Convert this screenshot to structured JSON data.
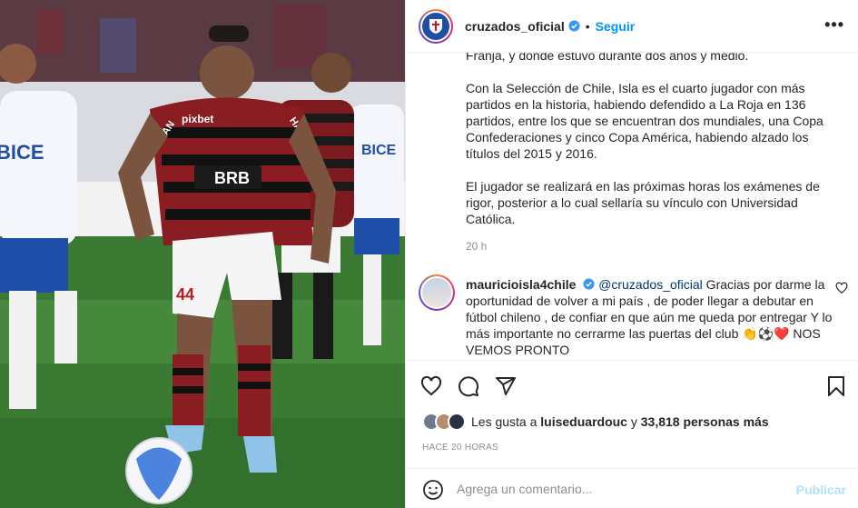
{
  "post": {
    "account": "cruzados_oficial",
    "follow_label": "Seguir",
    "separator": "•",
    "caption_paragraphs": [
      "Franja, y donde estuvo durante dos años y medio.",
      "Con la Selección de Chile, Isla es el cuarto jugador con más partidos en la historia, habiendo defendido a La Roja en 136 partidos, entre los que se encuentran dos mundiales, una Copa Confederaciones y cinco Copa América, habiendo alzado los títulos del 2015 y 2016.",
      "El jugador se realizará en las próximas horas los exámenes de rigor, posterior a lo cual sellaría su vínculo con Universidad Católica."
    ],
    "time": "20 h"
  },
  "comment": {
    "user": "mauricioisla4chile",
    "mention": "@cruzados_oficial",
    "text": " Gracias por darme la oportunidad de volver a mi país , de poder llegar a debutar en fútbol chileno , de confiar en que aún me queda por entregar Y lo más importante no cerrarme las puertas del club 👏⚽❤️ NOS VEMOS PRONTO"
  },
  "likes": {
    "prefix": "Les gusta a ",
    "user": "luiseduardouc",
    "middle": " y ",
    "count": "33,818 personas más"
  },
  "posted_ago": "HACE 20 HORAS",
  "comment_box": {
    "placeholder": "Agrega un comentario...",
    "publish_label": "Publicar"
  },
  "photo": {
    "jersey_sponsor_1": "pixbet",
    "jersey_sponsor_2": "HAVAN",
    "jersey_sponsor_3": "BRB",
    "opponent_sponsor": "BICE",
    "shorts_number": "44"
  },
  "colors": {
    "accent": "#0095f6",
    "verified": "#3897f0",
    "heart": "#ed4956",
    "publish_disabled": "#b2dffc"
  }
}
